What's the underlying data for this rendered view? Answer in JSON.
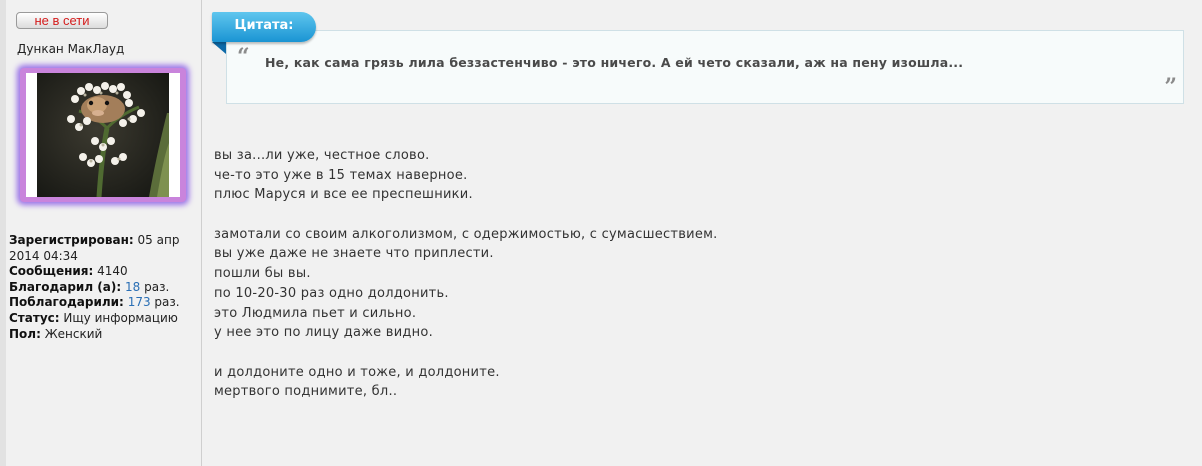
{
  "user": {
    "status": "не в сети",
    "name": "Дункан МакЛауд",
    "info": {
      "registered_label": "Зарегистрирован:",
      "registered_value_1": " 05 апр",
      "registered_value_2": "2014 04:34",
      "messages_label": "Сообщения:",
      "messages_value": " 4140",
      "thanked_label": "Благодарил (а):",
      "thanked_count": "18",
      "thanked_suffix": " раз.",
      "was_thanked_label": "Поблагодарили:",
      "was_thanked_count": "173",
      "was_thanked_suffix": " раз.",
      "status_label": "Статус:",
      "status_value": " Ищу информацию",
      "gender_label": "Пол:",
      "gender_value": " Женский"
    }
  },
  "quote": {
    "label": "Цитата:",
    "open_mark": "“",
    "close_mark": "”",
    "text": "Не, как сама грязь лила беззастенчиво - это ничего. А ей чето сказали, аж на пену изошла..."
  },
  "post": {
    "lines": [
      "вы за...ли уже, честное слово.",
      "че-то это уже в 15 темах наверное.",
      "плюс Маруся и все ее преспешники.",
      "",
      "замотали со своим алкоголизмом, с одержимостью, с сумасшествием.",
      "вы уже даже не знаете что приплести.",
      "пошли бы вы.",
      "по 10-20-30 раз одно долдонить.",
      "это Людмила пьет и сильно.",
      "у нее это по лицу даже видно.",
      "",
      "и долдоните одно и тоже, и долдоните.",
      "мертвого поднимите, бл.."
    ]
  },
  "colors": {
    "offline": "#d41c1c",
    "link": "#2a6fb5",
    "quote_label": "#1a94d3",
    "avatar_frame": "#c984dc"
  }
}
